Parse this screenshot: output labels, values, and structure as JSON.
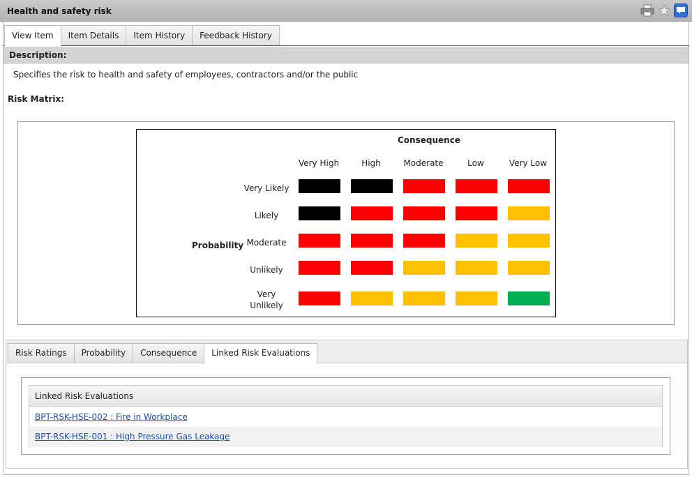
{
  "window": {
    "title": "Health and safety risk"
  },
  "toolbar_icons": [
    "printer-icon",
    "star-icon",
    "feedback-icon"
  ],
  "main_tabs": [
    {
      "label": "View Item",
      "active": true
    },
    {
      "label": "Item Details",
      "active": false
    },
    {
      "label": "Item History",
      "active": false
    },
    {
      "label": "Feedback History",
      "active": false
    }
  ],
  "description": {
    "header": "Description:",
    "text": "Specifies the risk to health and safety of employees, contractors and/or the public"
  },
  "risk_matrix": {
    "label": "Risk Matrix:",
    "consequence_title": "Consequence",
    "probability_title": "Probability",
    "columns": [
      "Very High",
      "High",
      "Moderate",
      "Low",
      "Very Low"
    ],
    "rows": [
      "Very Likely",
      "Likely",
      "Moderate",
      "Unlikely",
      "Very Unlikely"
    ],
    "colors": {
      "black": "#000000",
      "red": "#ff0000",
      "amber": "#ffc000",
      "green": "#00b050"
    },
    "cells": [
      [
        "black",
        "black",
        "red",
        "red",
        "red"
      ],
      [
        "black",
        "red",
        "red",
        "red",
        "amber"
      ],
      [
        "red",
        "red",
        "red",
        "amber",
        "amber"
      ],
      [
        "red",
        "red",
        "amber",
        "amber",
        "amber"
      ],
      [
        "red",
        "amber",
        "amber",
        "amber",
        "green"
      ]
    ]
  },
  "sub_tabs": [
    {
      "label": "Risk Ratings",
      "active": false
    },
    {
      "label": "Probability",
      "active": false
    },
    {
      "label": "Consequence",
      "active": false
    },
    {
      "label": "Linked Risk Evaluations",
      "active": true
    }
  ],
  "linked_evaluations": {
    "header": "Linked Risk Evaluations",
    "items": [
      "BPT-RSK-HSE-002 : Fire in Workplace",
      "BPT-RSK-HSE-001 : High Pressure Gas Leakage"
    ]
  }
}
